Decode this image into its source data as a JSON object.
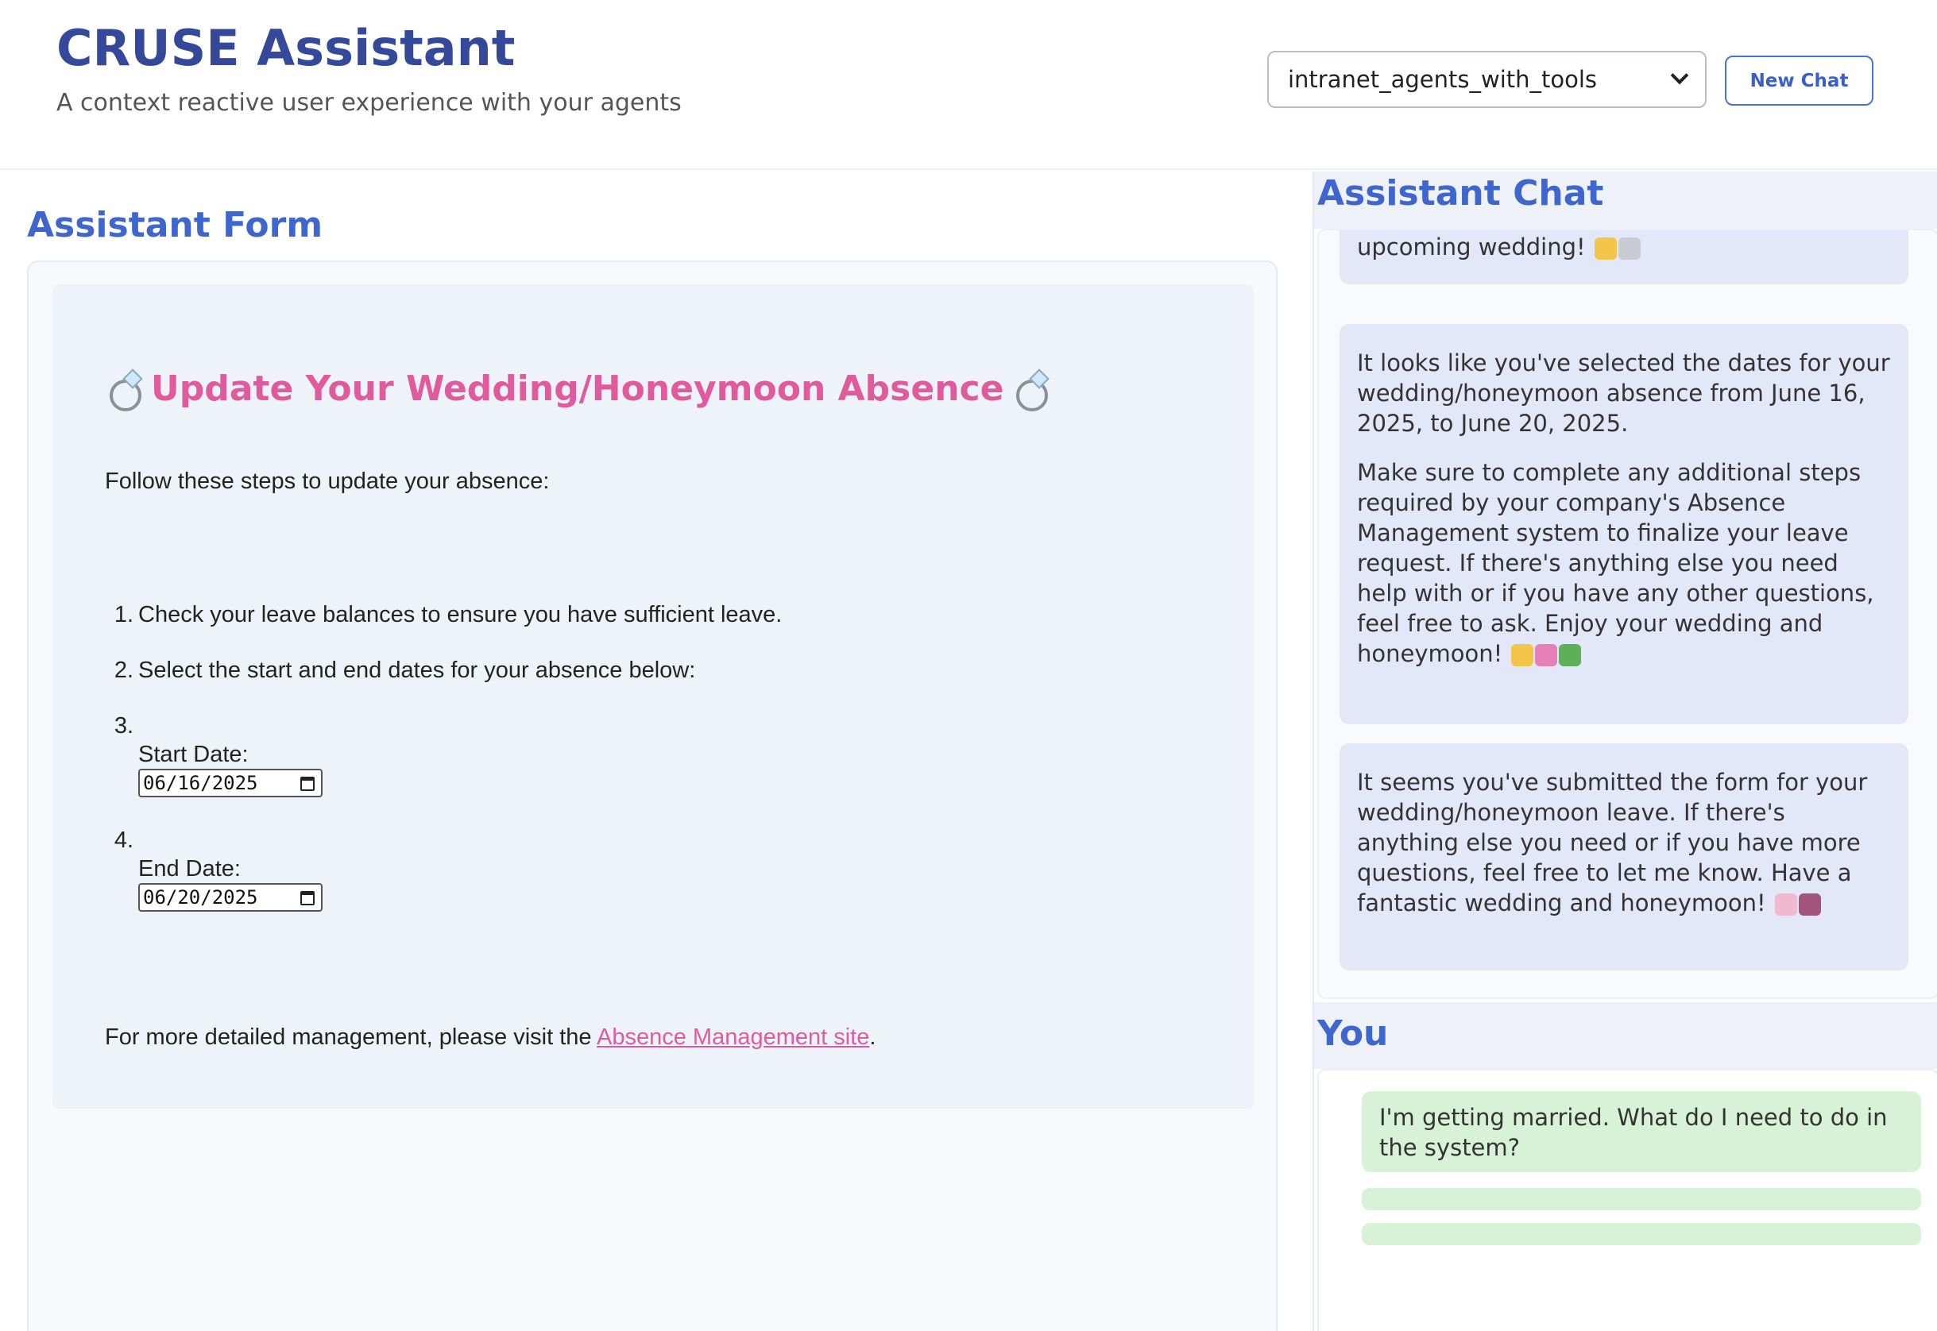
{
  "header": {
    "title": "CRUSE Assistant",
    "subtitle": "A context reactive user experience with your agents",
    "agent_select_value": "intranet_agents_with_tools",
    "new_chat_label": "New Chat"
  },
  "form_section": {
    "title": "Assistant Form",
    "heading": "Update Your Wedding/Honeymoon Absence",
    "intro": "Follow these steps to update your absence:",
    "steps": [
      "Check your leave balances to ensure you have sufficient leave.",
      "Select the start and end dates for your absence below:"
    ],
    "step_numbers": [
      "1.",
      "2.",
      "3.",
      "4."
    ],
    "start_date_label": "Start Date:",
    "start_date_value": "06/16/2025",
    "end_date_label": "End Date:",
    "end_date_value": "06/20/2025",
    "more_info_prefix": "For more detailed management, please visit the ",
    "more_info_link": "Absence Management site",
    "more_info_suffix": "."
  },
  "chat_section": {
    "title": "Assistant Chat",
    "messages": [
      "upcoming wedding!",
      "It looks like you've selected the dates for your wedding/honeymoon absence from June 16, 2025, to June 20, 2025.",
      "Make sure to complete any additional steps required by your company's Absence Management system to finalize your leave request. If there's anything else you need help with or if you have any other questions, feel free to ask. Enjoy your wedding and honeymoon!",
      "It seems you've submitted the form for your wedding/honeymoon leave. If there's anything else you need or if you have more questions, feel free to let me know. Have a fantastic wedding and honeymoon!"
    ]
  },
  "you_section": {
    "title": "You",
    "user_message": "I'm getting married. What do I need to do in the system?"
  },
  "colors": {
    "brand_title": "#34499a",
    "section_title": "#3f66cc",
    "form_heading": "#e05a9e",
    "assistant_bubble": "#e3e8f9",
    "user_bubble": "#d7f2d7"
  }
}
